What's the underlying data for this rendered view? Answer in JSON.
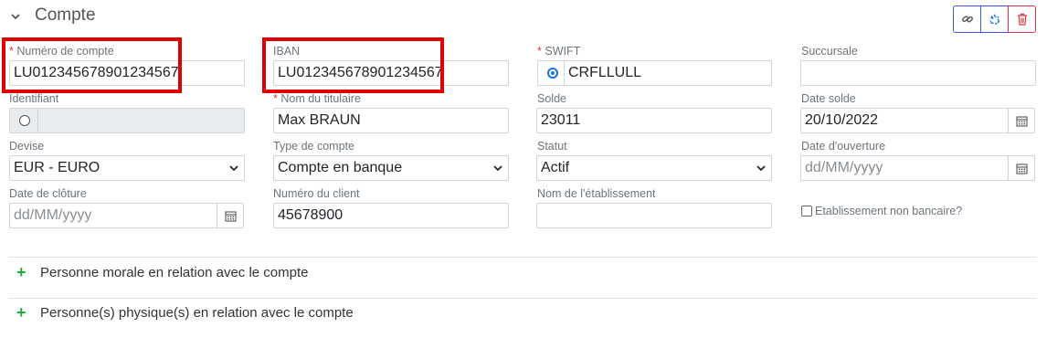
{
  "section": {
    "title": "Compte"
  },
  "actions": {
    "link_icon": "link-icon",
    "recycle_icon": "recycle-icon",
    "delete_icon": "trash-icon"
  },
  "fields": {
    "numero_compte": {
      "label": "Numéro de compte",
      "required_mark": "*",
      "value": "LU012345678901234567"
    },
    "iban": {
      "label": "IBAN",
      "value": "LU012345678901234567"
    },
    "swift": {
      "label": "SWIFT",
      "required_mark": "*",
      "value": "CRFLLULL"
    },
    "succursale": {
      "label": "Succursale",
      "value": ""
    },
    "identifiant": {
      "label": "Identifiant",
      "value": ""
    },
    "nom_titulaire": {
      "label": "Nom du titulaire",
      "required_mark": "*",
      "value": "Max BRAUN"
    },
    "solde": {
      "label": "Solde",
      "value": "23011"
    },
    "date_solde": {
      "label": "Date solde",
      "value": "20/10/2022"
    },
    "devise": {
      "label": "Devise",
      "value": "EUR - EURO"
    },
    "type_compte": {
      "label": "Type de compte",
      "value": "Compte en banque"
    },
    "statut": {
      "label": "Statut",
      "value": "Actif"
    },
    "date_ouverture": {
      "label": "Date d'ouverture",
      "placeholder": "dd/MM/yyyy"
    },
    "date_cloture": {
      "label": "Date de clôture",
      "placeholder": "dd/MM/yyyy"
    },
    "numero_client": {
      "label": "Numéro du client",
      "value": "45678900"
    },
    "nom_etablissement": {
      "label": "Nom de l'établissement",
      "value": ""
    },
    "etablissement_non_bancaire": {
      "label": "Etablissement non bancaire?",
      "checked": false
    }
  },
  "related": {
    "personne_morale": "Personne morale en relation avec le compte",
    "personnes_physiques": "Personne(s) physique(s) en relation avec le compte"
  },
  "colors": {
    "accent": "#1a73e8",
    "danger": "#dc3545",
    "highlight": "#e00000",
    "plus": "#28a745"
  }
}
